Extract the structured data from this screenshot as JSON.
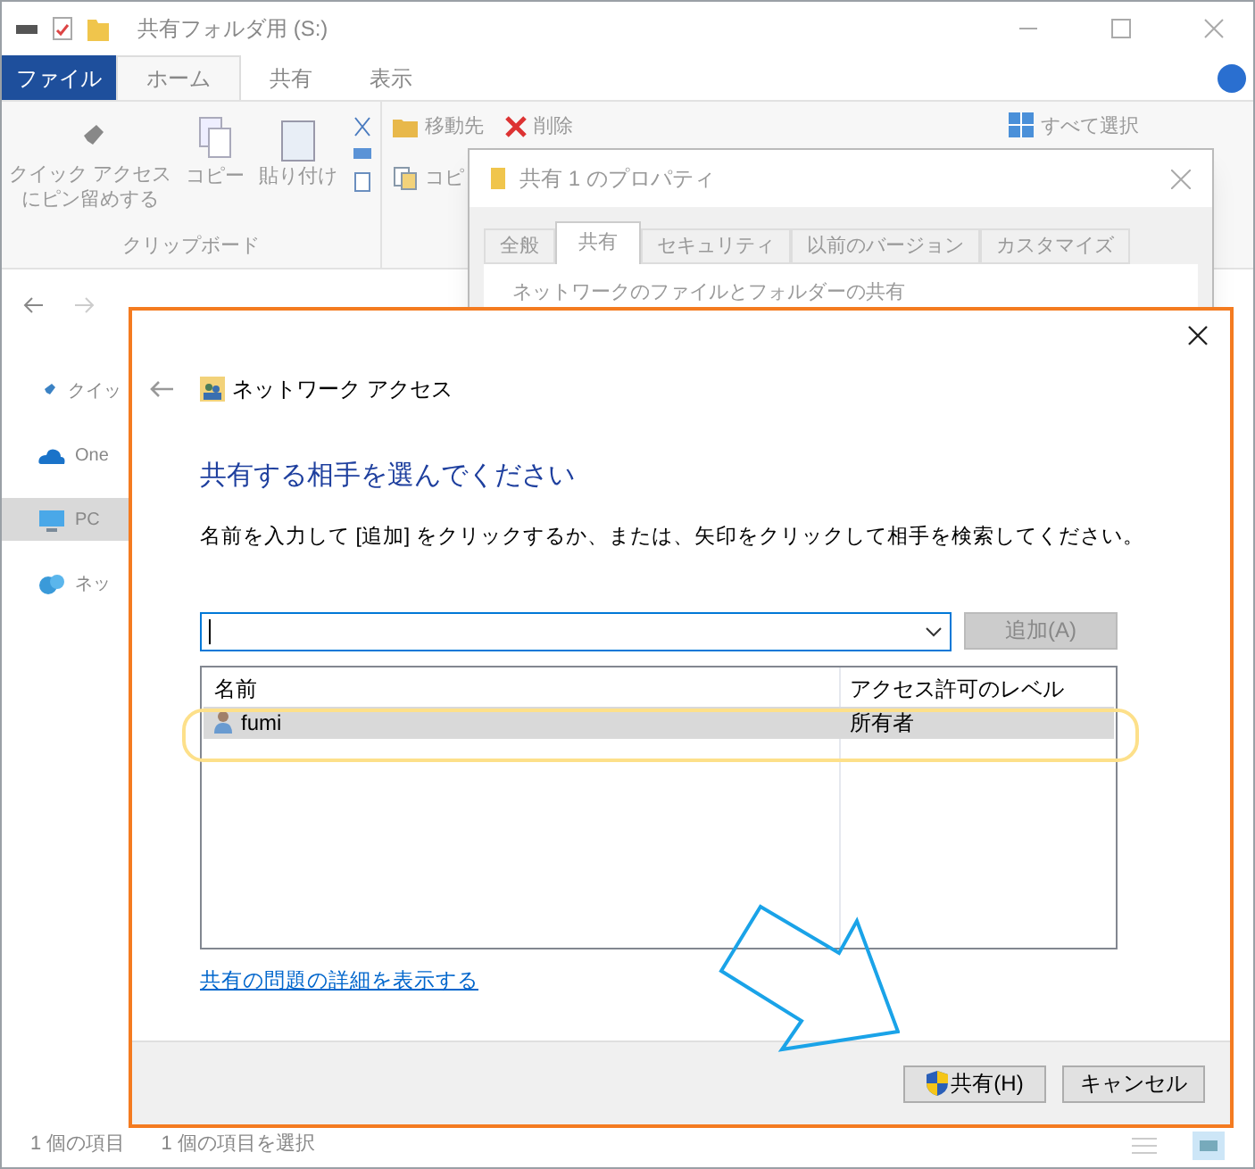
{
  "explorer": {
    "title": "共有フォルダ用 (S:)",
    "file_tab": "ファイル",
    "ribbon_tabs": [
      {
        "label": "ホーム",
        "selected": true
      },
      {
        "label": "共有",
        "selected": false
      },
      {
        "label": "表示",
        "selected": false
      }
    ],
    "clipboard": {
      "pin_label": [
        "クイック アクセス",
        "にピン留めする"
      ],
      "copy_label": "コピー",
      "paste_label": "貼り付け",
      "group_label": "クリップボード"
    },
    "organize": [
      {
        "label": "移動先",
        "kind": "move"
      },
      {
        "label": "削除",
        "kind": "delete"
      },
      {
        "label": "コピ",
        "kind": "copy"
      }
    ],
    "select_all": "すべて選択",
    "sidebar": [
      {
        "label": "クイッ",
        "kind": "pin",
        "selected": false
      },
      {
        "label": "One",
        "kind": "cloud",
        "selected": false
      },
      {
        "label": "PC",
        "kind": "pc",
        "selected": true
      },
      {
        "label": "ネッ",
        "kind": "network",
        "selected": false
      }
    ],
    "status_bar": [
      "1 個の項目",
      "1 個の項目を選択"
    ]
  },
  "properties": {
    "title": "共有 1 のプロパティ",
    "tabs": [
      {
        "label": "全般",
        "selected": false
      },
      {
        "label": "共有",
        "selected": true
      },
      {
        "label": "セキュリティ",
        "selected": false
      },
      {
        "label": "以前のバージョン",
        "selected": false
      },
      {
        "label": "カスタマイズ",
        "selected": false
      }
    ],
    "group_label": "ネットワークのファイルとフォルダーの共有"
  },
  "dialog": {
    "title": "ネットワーク アクセス",
    "heading": "共有する相手を選んでください",
    "instruction": "名前を入力して [追加] をクリックするか、または、矢印をクリックして相手を検索してください。",
    "add_button": {
      "label": "追加(A)",
      "disabled": true
    },
    "columns": [
      "名前",
      "アクセス許可のレベル"
    ],
    "rows": [
      {
        "name": "fumi",
        "permission": "所有者",
        "selected": true
      }
    ],
    "link": "共有の問題の詳細を表示する",
    "buttons": [
      {
        "label": "共有(H)",
        "kind": "shield"
      },
      {
        "label": "キャンセル",
        "kind": "plain"
      }
    ]
  }
}
